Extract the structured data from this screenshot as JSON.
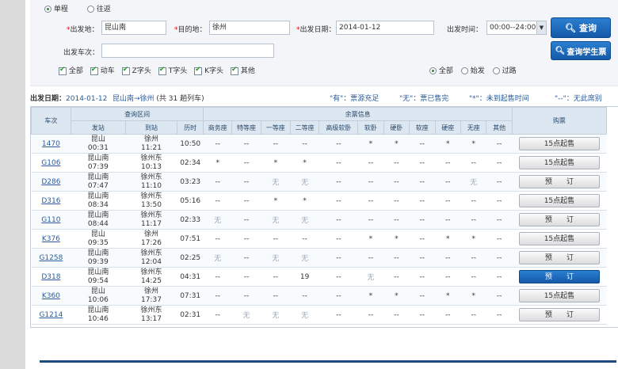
{
  "trip": {
    "oneway": "单程",
    "roundtrip": "往返"
  },
  "form": {
    "from_label": "出发地：",
    "from_value": "昆山南",
    "to_label": "目的地：",
    "to_value": "徐州",
    "date_label": "出发日期：",
    "date_value": "2014-01-12",
    "time_label": "出发时间：",
    "time_value": "00:00--24:00",
    "train_label": "出发车次：",
    "train_value": ""
  },
  "buttons": {
    "query": "查询",
    "student_query": "查询学生票"
  },
  "filters": [
    "全部",
    "动车",
    "Z字头",
    "T字头",
    "K字头",
    "其他"
  ],
  "station_filters": [
    "全部",
    "始发",
    "过路"
  ],
  "info": {
    "date_label": "出发日期：",
    "date_value": "2014-01-12",
    "route": "昆山南→徐州",
    "count": "(共 31 趟列车)",
    "legend_you": "\"有\"：票源充足",
    "legend_wu": "\"无\"：票已售完",
    "legend_star": "\"*\"：未到起售时间",
    "legend_dash": "\"--\"：无此席别"
  },
  "table": {
    "group_query": "查询区间",
    "group_seat": "余票信息",
    "col_train": "车次",
    "col_book": "购票",
    "sub": [
      "发站",
      "到站",
      "历时",
      "商务座",
      "特等座",
      "一等座",
      "二等座",
      "高级软卧",
      "软卧",
      "硬卧",
      "软座",
      "硬座",
      "无座",
      "其他"
    ],
    "rows": [
      {
        "no": "1470",
        "from": "昆山",
        "dep": "00:31",
        "to": "徐州",
        "arr": "11:21",
        "dur": "10:50",
        "seats": [
          "--",
          "--",
          "--",
          "--",
          "--",
          "*",
          "*",
          "--",
          "*",
          "*",
          "--"
        ],
        "book": "15点起售",
        "blue": false
      },
      {
        "no": "G106",
        "from": "昆山南",
        "dep": "07:39",
        "to": "徐州东",
        "arr": "10:13",
        "dur": "02:34",
        "seats": [
          "*",
          "--",
          "*",
          "*",
          "--",
          "--",
          "--",
          "--",
          "--",
          "--",
          "--"
        ],
        "book": "15点起售",
        "blue": false
      },
      {
        "no": "D286",
        "from": "昆山南",
        "dep": "07:47",
        "to": "徐州东",
        "arr": "11:10",
        "dur": "03:23",
        "seats": [
          "--",
          "--",
          "无",
          "无",
          "--",
          "--",
          "--",
          "--",
          "--",
          "无",
          "--"
        ],
        "book": "预　　订",
        "blue": false
      },
      {
        "no": "D316",
        "from": "昆山南",
        "dep": "08:34",
        "to": "徐州东",
        "arr": "13:50",
        "dur": "05:16",
        "seats": [
          "--",
          "--",
          "*",
          "*",
          "--",
          "--",
          "--",
          "--",
          "--",
          "--",
          "--"
        ],
        "book": "15点起售",
        "blue": false
      },
      {
        "no": "G110",
        "from": "昆山南",
        "dep": "08:44",
        "to": "徐州东",
        "arr": "11:17",
        "dur": "02:33",
        "seats": [
          "无",
          "--",
          "无",
          "无",
          "--",
          "--",
          "--",
          "--",
          "--",
          "--",
          "--"
        ],
        "book": "预　　订",
        "blue": false
      },
      {
        "no": "K376",
        "from": "昆山",
        "dep": "09:35",
        "to": "徐州",
        "arr": "17:26",
        "dur": "07:51",
        "seats": [
          "--",
          "--",
          "--",
          "--",
          "--",
          "*",
          "*",
          "--",
          "*",
          "*",
          "--"
        ],
        "book": "15点起售",
        "blue": false
      },
      {
        "no": "G1258",
        "from": "昆山南",
        "dep": "09:39",
        "to": "徐州东",
        "arr": "12:04",
        "dur": "02:25",
        "seats": [
          "无",
          "--",
          "无",
          "无",
          "--",
          "--",
          "--",
          "--",
          "--",
          "--",
          "--"
        ],
        "book": "预　　订",
        "blue": false
      },
      {
        "no": "D318",
        "from": "昆山南",
        "dep": "09:54",
        "to": "徐州东",
        "arr": "14:25",
        "dur": "04:31",
        "seats": [
          "--",
          "--",
          "--",
          "19",
          "--",
          "无",
          "--",
          "--",
          "--",
          "--",
          "--"
        ],
        "book": "预　　订",
        "blue": true
      },
      {
        "no": "K360",
        "from": "昆山",
        "dep": "10:06",
        "to": "徐州",
        "arr": "17:37",
        "dur": "07:31",
        "seats": [
          "--",
          "--",
          "--",
          "--",
          "--",
          "*",
          "*",
          "--",
          "*",
          "*",
          "--"
        ],
        "book": "15点起售",
        "blue": false
      },
      {
        "no": "G1214",
        "from": "昆山南",
        "dep": "10:46",
        "to": "徐州东",
        "arr": "13:17",
        "dur": "02:31",
        "seats": [
          "--",
          "无",
          "无",
          "无",
          "--",
          "--",
          "--",
          "--",
          "--",
          "--",
          "--"
        ],
        "book": "预　　订",
        "blue": false
      }
    ]
  }
}
